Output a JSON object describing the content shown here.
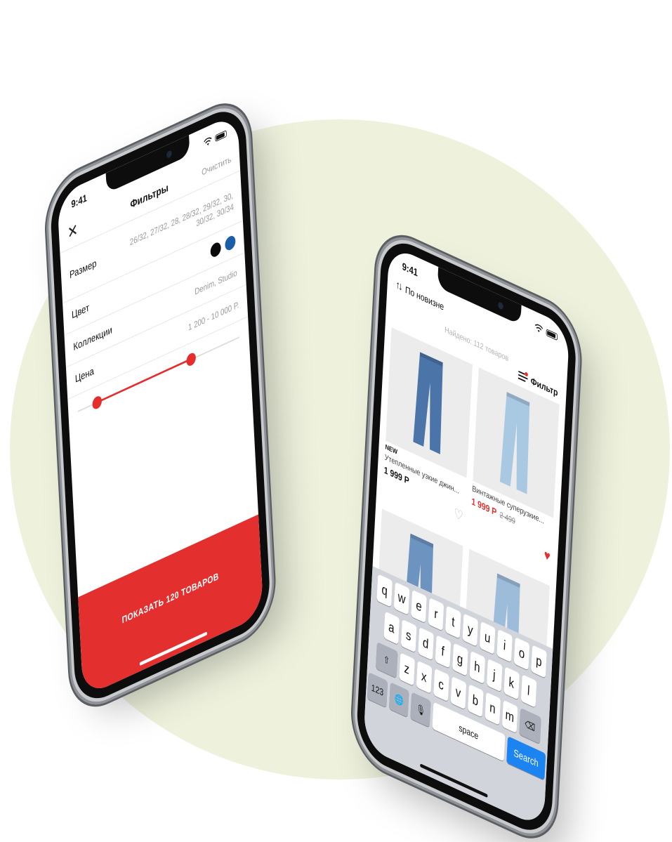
{
  "filters_phone": {
    "time": "9:41",
    "title": "Фильтры",
    "clear_label": "Очистить",
    "close_icon": "close-icon",
    "rows": {
      "size": {
        "label": "Размер",
        "value": "26/32, 27/32, 28, 28/32, 29/32, 30, 30/32, 30/34"
      },
      "color": {
        "label": "Цвет",
        "swatches": [
          "#0a0a0a",
          "#1a5fa8"
        ]
      },
      "collections": {
        "label": "Коллекции",
        "value": "Denim, Studio"
      },
      "price": {
        "label": "Цена",
        "value": "1 200 - 10 000 Р."
      }
    },
    "slider": {
      "min_fraction": 0.12,
      "max_fraction": 0.7
    },
    "show_button": "ПОКАЗАТЬ 120 ТОВАРОВ",
    "accent_color": "#e42f2f"
  },
  "catalog_phone": {
    "time": "9:41",
    "sort_label": "По новизне",
    "found_label": "Найдено: 112 товаров",
    "filter_label": "Фильтр",
    "products": [
      {
        "badge": "NEW",
        "name": "Утепленные узкие джин...",
        "price": "1 999 Р",
        "old_price": "",
        "sale": false,
        "favorite": false,
        "color": "#4b74a8"
      },
      {
        "badge": "",
        "name": "Винтажные суперузкие...",
        "price": "1 999 Р",
        "old_price": "2 499",
        "sale": true,
        "favorite": true,
        "color": "#a9c8e2"
      },
      {
        "badge": "",
        "name": "",
        "price": "",
        "old_price": "",
        "sale": false,
        "favorite": false,
        "color": "#6d93c1"
      },
      {
        "badge": "",
        "name": "",
        "price": "",
        "old_price": "",
        "sale": false,
        "favorite": false,
        "color": "#9dbcd9"
      }
    ],
    "keyboard": {
      "row1": [
        "q",
        "w",
        "e",
        "r",
        "t",
        "y",
        "u",
        "i",
        "o",
        "p"
      ],
      "row2": [
        "a",
        "s",
        "d",
        "f",
        "g",
        "h",
        "j",
        "k",
        "l"
      ],
      "row3": [
        "z",
        "x",
        "c",
        "v",
        "b",
        "n",
        "m"
      ],
      "shift": "⇧",
      "backspace": "⌫",
      "numbers": "123",
      "globe": "🌐",
      "mic": "🎙",
      "space": "space",
      "search": "Search"
    }
  }
}
